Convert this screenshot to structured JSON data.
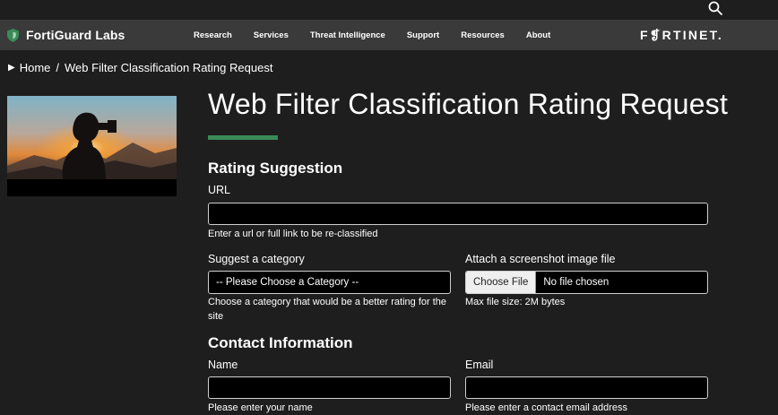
{
  "header": {
    "brand_name": "FortiGuard Labs",
    "logo_text": "F❡RTINET.",
    "nav": [
      "Research",
      "Services",
      "Threat Intelligence",
      "Support",
      "Resources",
      "About"
    ],
    "search_icon": "search-icon",
    "shield_icon": "shield-icon"
  },
  "breadcrumb": {
    "home": "Home",
    "separator": "/",
    "current": "Web Filter Classification Rating Request"
  },
  "page": {
    "title": "Web Filter Classification Rating Request",
    "accent_color": "#3a8a57"
  },
  "rating": {
    "section_title": "Rating Suggestion",
    "url_label": "URL",
    "url_value": "",
    "url_help": "Enter a url or full link to be re-classified",
    "category_label": "Suggest a category",
    "category_selected": "-- Please Choose a Category --",
    "category_help": "Choose a category that would be a better rating for the site",
    "attach_label": "Attach a screenshot image file",
    "file_button": "Choose File",
    "file_status": "No file chosen",
    "file_help": "Max file size: 2M bytes"
  },
  "contact": {
    "section_title": "Contact Information",
    "name_label": "Name",
    "name_value": "",
    "name_help": "Please enter your name",
    "email_label": "Email",
    "email_value": "",
    "email_help": "Please enter a contact email address"
  }
}
